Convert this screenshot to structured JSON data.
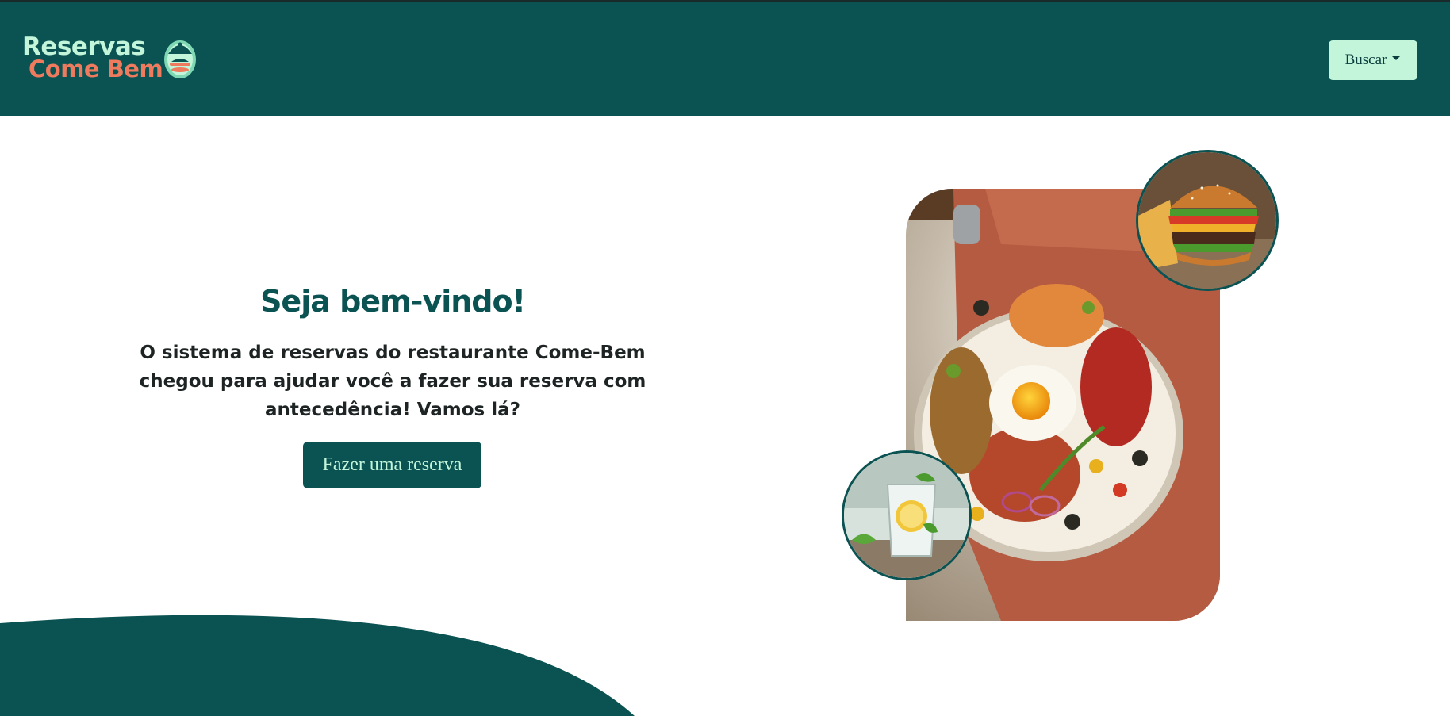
{
  "header": {
    "logo": {
      "line1": "Reservas",
      "line2": "Come Bem",
      "emblem_icon": "dining-cloche-icon"
    },
    "search_button": {
      "label": "Buscar",
      "icon": "caret-down-icon"
    }
  },
  "hero": {
    "title": "Seja bem-vindo!",
    "text": "O sistema de reservas do restaurante Come-Bem chegou para ajudar você a fazer sua reserva com antecedência! Vamos lá?",
    "cta_label": "Fazer uma reserva"
  },
  "images": {
    "main": "food-plate-image",
    "top_circle": "burger-image",
    "bottom_circle": "lemon-drink-image"
  },
  "colors": {
    "primary": "#0b5352",
    "accent_mint": "#c2f5da",
    "accent_coral": "#f07a5d",
    "text_dark": "#1e2424"
  }
}
